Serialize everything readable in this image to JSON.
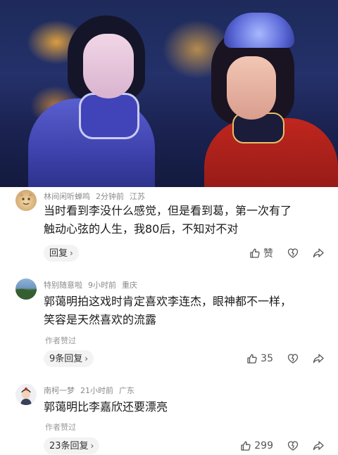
{
  "comments": [
    {
      "username": "林间闲听蝉鸣",
      "time": "2分钟前",
      "location": "江苏",
      "text_line1": "当时看到李没什么感觉，但是看到葛，第一次有了",
      "text_line2": "触动心弦的人生，我80后，不知对不对",
      "author_liked": "",
      "reply_label": "回复",
      "like_label": "赞"
    },
    {
      "username": "特别随意啦",
      "time": "9小时前",
      "location": "重庆",
      "text_line1": "郭蔼明拍这戏时肯定喜欢李连杰，眼神都不一样，",
      "text_line2": "笑容是天然喜欢的流露",
      "author_liked": "作者赞过",
      "reply_label": "9条回复",
      "like_label": "35"
    },
    {
      "username": "南柯一梦",
      "time": "21小时前",
      "location": "广东",
      "text_line1": "郭蔼明比李嘉欣还要漂亮",
      "text_line2": "",
      "author_liked": "作者赞过",
      "reply_label": "23条回复",
      "like_label": "299"
    }
  ],
  "icons": {
    "like": "like-icon",
    "dislike": "dislike-icon",
    "share": "share-icon",
    "chevron": "›"
  }
}
